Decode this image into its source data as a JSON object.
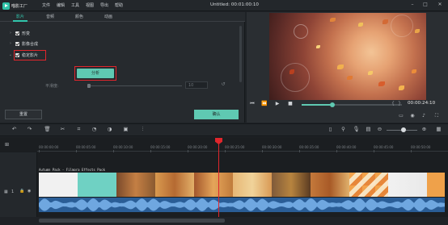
{
  "app": {
    "logo_text": "喵影工厂",
    "title": "Untitled: 00:01:00:10"
  },
  "menu": [
    "文件",
    "编辑",
    "工具",
    "视图",
    "导出",
    "帮助"
  ],
  "tabs": [
    "影片",
    "音频",
    "颜色",
    "动画"
  ],
  "effects_tree": [
    {
      "label": "形变"
    },
    {
      "label": "影像合成"
    },
    {
      "label": "稳定影片"
    }
  ],
  "stabilize": {
    "analyze_label": "分析",
    "smooth_label": "平滑度:",
    "smooth_value": "10"
  },
  "footer_buttons": {
    "reset_label": "重置",
    "ok_label": "确认"
  },
  "player": {
    "timecode": "00:00:24:10",
    "progress": 0.3
  },
  "timeline": {
    "ticks": [
      "00:00:00:00",
      "00:00:05:00",
      "00:00:10:00",
      "00:00:15:00",
      "00:00:20:00",
      "00:00:25:00",
      "00:00:30:00",
      "00:00:35:00",
      "00:00:40:00",
      "00:00:45:00",
      "00:00:50:00"
    ],
    "clip_title": "Autumn Pack - Filmora Effects Pack",
    "track_label": "1"
  },
  "colors": {
    "accent": "#5fc9b2",
    "highlight": "#e0262c",
    "audio": "#2a5d96"
  }
}
